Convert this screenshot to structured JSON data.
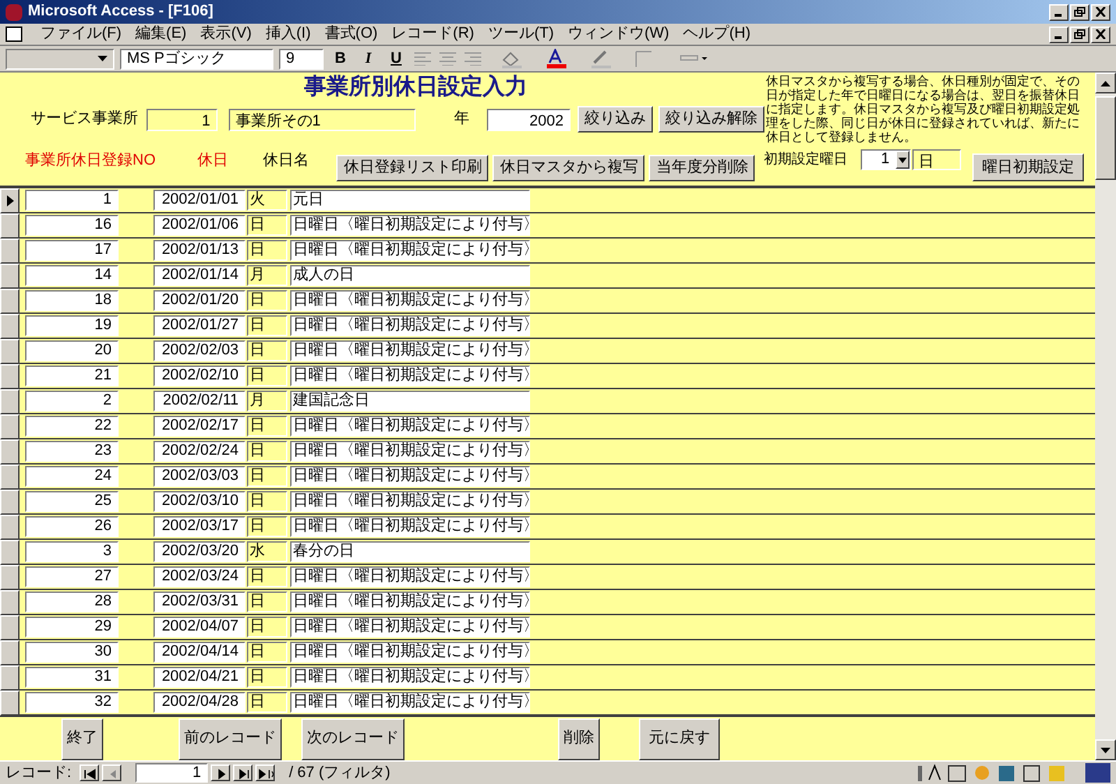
{
  "window": {
    "title": "Microsoft Access - [F106]"
  },
  "menu": [
    "ファイル(F)",
    "編集(E)",
    "表示(V)",
    "挿入(I)",
    "書式(O)",
    "レコード(R)",
    "ツール(T)",
    "ウィンドウ(W)",
    "ヘルプ(H)"
  ],
  "toolbar": {
    "font": "MS Pゴシック",
    "size": "9",
    "bold": "B",
    "italic": "I",
    "underline": "U"
  },
  "form": {
    "title": "事業所別休日設定入力",
    "office_label": "サービス事業所",
    "office_no": "1",
    "office_name": "事業所その1",
    "year_label": "年",
    "year": "2002",
    "filter_button": "絞り込み",
    "unfilter_button": "絞り込み解除",
    "note": "休日マスタから複写する場合、休日種別が固定で、その日が指定した年で日曜日になる場合は、翌日を振替休日に指定します。休日マスタから複写及び曜日初期設定処理をした際、同じ日が休日に登録されていれば、新たに休日として登録しません。",
    "col_no": "事業所休日登録NO",
    "col_date": "休日",
    "col_name": "休日名",
    "actions": [
      "休日登録リスト印刷",
      "休日マスタから複写",
      "当年度分削除"
    ],
    "init_label": "初期設定曜日",
    "init_value": "1",
    "init_day": "日",
    "init_button": "曜日初期設定"
  },
  "rows": [
    {
      "no": "1",
      "date": "2002/01/01",
      "weekday": "火",
      "name": "元日",
      "selected": true
    },
    {
      "no": "16",
      "date": "2002/01/06",
      "weekday": "日",
      "name": "日曜日〈曜日初期設定により付与〉",
      "selected": false
    },
    {
      "no": "17",
      "date": "2002/01/13",
      "weekday": "日",
      "name": "日曜日〈曜日初期設定により付与〉",
      "selected": false
    },
    {
      "no": "14",
      "date": "2002/01/14",
      "weekday": "月",
      "name": "成人の日",
      "selected": false
    },
    {
      "no": "18",
      "date": "2002/01/20",
      "weekday": "日",
      "name": "日曜日〈曜日初期設定により付与〉",
      "selected": false
    },
    {
      "no": "19",
      "date": "2002/01/27",
      "weekday": "日",
      "name": "日曜日〈曜日初期設定により付与〉",
      "selected": false
    },
    {
      "no": "20",
      "date": "2002/02/03",
      "weekday": "日",
      "name": "日曜日〈曜日初期設定により付与〉",
      "selected": false
    },
    {
      "no": "21",
      "date": "2002/02/10",
      "weekday": "日",
      "name": "日曜日〈曜日初期設定により付与〉",
      "selected": false
    },
    {
      "no": "2",
      "date": "2002/02/11",
      "weekday": "月",
      "name": "建国記念日",
      "selected": false
    },
    {
      "no": "22",
      "date": "2002/02/17",
      "weekday": "日",
      "name": "日曜日〈曜日初期設定により付与〉",
      "selected": false
    },
    {
      "no": "23",
      "date": "2002/02/24",
      "weekday": "日",
      "name": "日曜日〈曜日初期設定により付与〉",
      "selected": false
    },
    {
      "no": "24",
      "date": "2002/03/03",
      "weekday": "日",
      "name": "日曜日〈曜日初期設定により付与〉",
      "selected": false
    },
    {
      "no": "25",
      "date": "2002/03/10",
      "weekday": "日",
      "name": "日曜日〈曜日初期設定により付与〉",
      "selected": false
    },
    {
      "no": "26",
      "date": "2002/03/17",
      "weekday": "日",
      "name": "日曜日〈曜日初期設定により付与〉",
      "selected": false
    },
    {
      "no": "3",
      "date": "2002/03/20",
      "weekday": "水",
      "name": "春分の日",
      "selected": false
    },
    {
      "no": "27",
      "date": "2002/03/24",
      "weekday": "日",
      "name": "日曜日〈曜日初期設定により付与〉",
      "selected": false
    },
    {
      "no": "28",
      "date": "2002/03/31",
      "weekday": "日",
      "name": "日曜日〈曜日初期設定により付与〉",
      "selected": false
    },
    {
      "no": "29",
      "date": "2002/04/07",
      "weekday": "日",
      "name": "日曜日〈曜日初期設定により付与〉",
      "selected": false
    },
    {
      "no": "30",
      "date": "2002/04/14",
      "weekday": "日",
      "name": "日曜日〈曜日初期設定により付与〉",
      "selected": false
    },
    {
      "no": "31",
      "date": "2002/04/21",
      "weekday": "日",
      "name": "日曜日〈曜日初期設定により付与〉",
      "selected": false
    },
    {
      "no": "32",
      "date": "2002/04/28",
      "weekday": "日",
      "name": "日曜日〈曜日初期設定により付与〉",
      "selected": false
    }
  ],
  "footer": [
    "終了",
    "前のレコード",
    "次のレコード",
    "削除",
    "元に戻す"
  ],
  "navigator": {
    "label": "レコード:",
    "current": "1",
    "total": "/ 67 (フィルタ)"
  }
}
